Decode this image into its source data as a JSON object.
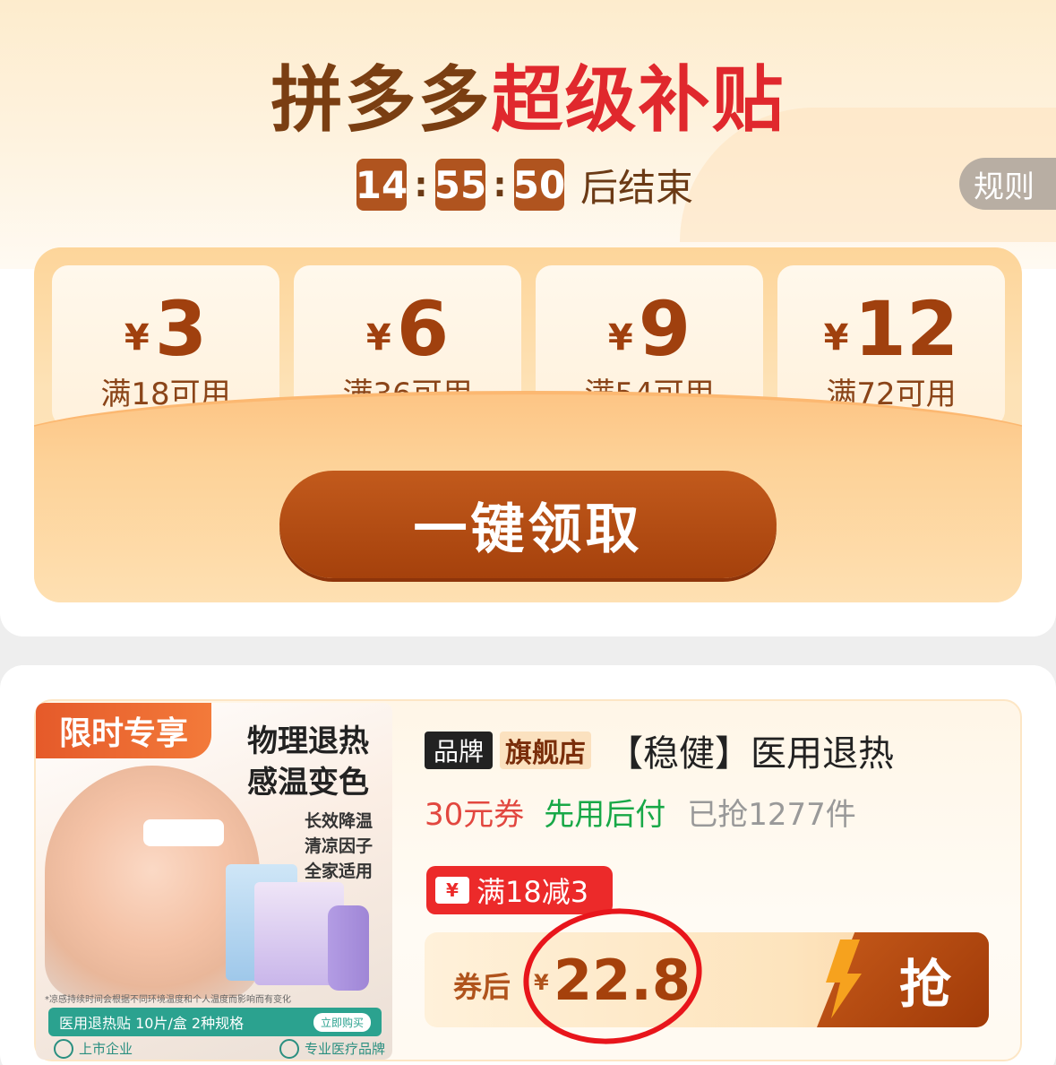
{
  "header": {
    "title_prefix": "拼多多",
    "title_highlight": "超级补贴",
    "countdown": {
      "h": "14",
      "m": "55",
      "s": "50",
      "sep": ":",
      "suffix": "后结束"
    },
    "rules_label": "规则"
  },
  "coupons": [
    {
      "currency": "¥",
      "amount": "3",
      "condition": "满18可用"
    },
    {
      "currency": "¥",
      "amount": "6",
      "condition": "满36可用"
    },
    {
      "currency": "¥",
      "amount": "9",
      "condition": "满54可用"
    },
    {
      "currency": "¥",
      "amount": "12",
      "condition": "满72可用"
    }
  ],
  "claim_all_label": "一键领取",
  "product": {
    "image": {
      "tag": "限时专享",
      "title_line1": "物理退热",
      "title_line2": "感温变色",
      "features": [
        "长效降温",
        "清凉因子",
        "全家适用"
      ],
      "note": "*凉感持续时间会根据不同环境温度和个人温度而影响而有变化",
      "strip_text": "医用退热贴 10片/盒 2种规格",
      "strip_action": "立即购买",
      "badge_left": "上市企业",
      "badge_right": "专业医疗品牌"
    },
    "brand_badge": "品牌",
    "flagship_badge": "旗舰店",
    "name": "【稳健】医用退热",
    "coupon_text": "30元券",
    "pay_later": "先用后付",
    "sold": "已抢1277件",
    "promo_icon": "¥",
    "promo": "满18减3",
    "price_label": "券后",
    "price_currency": "¥",
    "price": "22.8",
    "grab_label": "抢"
  },
  "colors": {
    "brand_brown": "#a5410c",
    "highlight_red": "#e0282d",
    "annotation_red": "#e8151b",
    "pay_green": "#18a847"
  },
  "icons": [
    "lightning-icon",
    "yen-ticket-icon",
    "company-icon",
    "medical-brand-icon"
  ]
}
